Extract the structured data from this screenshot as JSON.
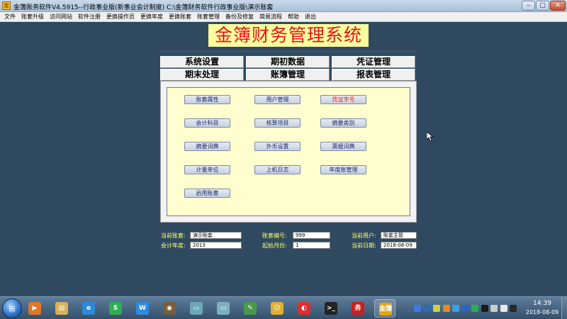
{
  "window": {
    "title": "金簿账务软件V4.5915--行政事业版(新事业会计制度)   C:\\金簿财务软件行政事业版\\演示账套",
    "icon_label": "金",
    "minimize_glyph": "‒",
    "maximize_glyph": "□",
    "close_glyph": "✕"
  },
  "menu": [
    "文件",
    "账套升级",
    "访问网站",
    "软件注册",
    "更换操作员",
    "更换年度",
    "更换账套",
    "账套管理",
    "备份及修复",
    "简易流程",
    "帮助",
    "退出"
  ],
  "banner": "金簿财务管理系统",
  "tabs": [
    "系统设置",
    "期初数据",
    "凭证管理",
    "期末处理",
    "账簿管理",
    "报表管理"
  ],
  "buttons": [
    "账套属性",
    "用户管理",
    "凭证字号",
    "会计科目",
    "核算项目",
    "摘要类别",
    "摘要词典",
    "外币设置",
    "票据词典",
    "计量单位",
    "上机日志",
    "年度账管理",
    "启用账套"
  ],
  "info": {
    "current_set_label": "当前账套:",
    "current_set_value": "演示账套",
    "set_no_label": "账套编号:",
    "set_no_value": "999",
    "current_user_label": "当前用户:",
    "current_user_value": "账套主管",
    "fiscal_year_label": "会计年度:",
    "fiscal_year_value": "2013",
    "start_month_label": "起始月份:",
    "start_month_value": "1",
    "current_date_label": "当前日期:",
    "current_date_value": "2018-08-09"
  },
  "taskbar": {
    "start_glyph": "⊞",
    "apps": [
      {
        "icon": "media-player-icon",
        "glyph": "▶",
        "color": "#e0762a"
      },
      {
        "icon": "file-explorer-icon",
        "glyph": "▤",
        "color": "#d9b25a"
      },
      {
        "icon": "ie-browser-icon",
        "glyph": "e",
        "color": "#2b8ad8"
      },
      {
        "icon": "s-app-icon",
        "glyph": "S",
        "color": "#2fae55"
      },
      {
        "icon": "w-app-icon",
        "glyph": "W",
        "color": "#2e8ce0"
      },
      {
        "icon": "eye-app-icon",
        "glyph": "◉",
        "color": "#7a5c3a"
      },
      {
        "icon": "window-app-icon",
        "glyph": "▭",
        "color": "#6ea8b8"
      },
      {
        "icon": "window-app-icon-2",
        "glyph": "▭",
        "color": "#7fb0c0"
      },
      {
        "icon": "tools-app-icon",
        "glyph": "✎",
        "color": "#4a9a4a"
      },
      {
        "icon": "person-app-icon",
        "glyph": "☺",
        "color": "#e0b030"
      },
      {
        "icon": "red-app-icon",
        "glyph": "◐",
        "color": "#d83030"
      },
      {
        "icon": "cmd-icon",
        "glyph": ">_",
        "color": "#222222"
      },
      {
        "icon": "red-badge-app-icon",
        "glyph": "务",
        "color": "#c82020"
      },
      {
        "icon": "jinbu-app-icon",
        "glyph": "金簿",
        "color": "#e2a515"
      }
    ],
    "tray": [
      "#3a7be0",
      "#2a6ab0",
      "#d0d040",
      "#e88a20",
      "#3aa0e0",
      "#2b62c4",
      "#2fae55",
      "#1a1a1a",
      "#cccccc",
      "#e8e8e8",
      "#2a2a2a"
    ],
    "time": "14:39",
    "date": "2018-08-09"
  }
}
